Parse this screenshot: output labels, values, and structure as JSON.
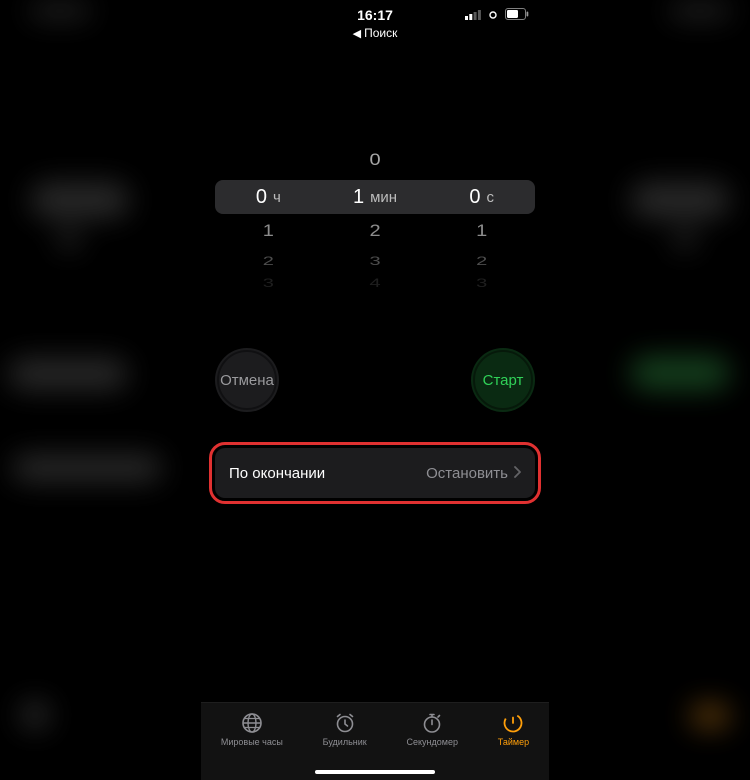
{
  "status": {
    "time": "16:17",
    "back_label": "Поиск"
  },
  "picker": {
    "hours": {
      "selected": "0",
      "unit": "ч",
      "below1": "1",
      "below2": "2",
      "below3": "3"
    },
    "minutes": {
      "above1": "0",
      "selected": "1",
      "unit": "мин",
      "below1": "2",
      "below2": "3",
      "below3": "4"
    },
    "seconds": {
      "selected": "0",
      "unit": "с",
      "below1": "1",
      "below2": "2",
      "below3": "3"
    }
  },
  "buttons": {
    "cancel": "Отмена",
    "start": "Старт"
  },
  "when_ends": {
    "label": "По окончании",
    "value": "Остановить"
  },
  "tabs": {
    "world_clock": "Мировые часы",
    "alarm": "Будильник",
    "stopwatch": "Секундомер",
    "timer": "Таймер"
  }
}
